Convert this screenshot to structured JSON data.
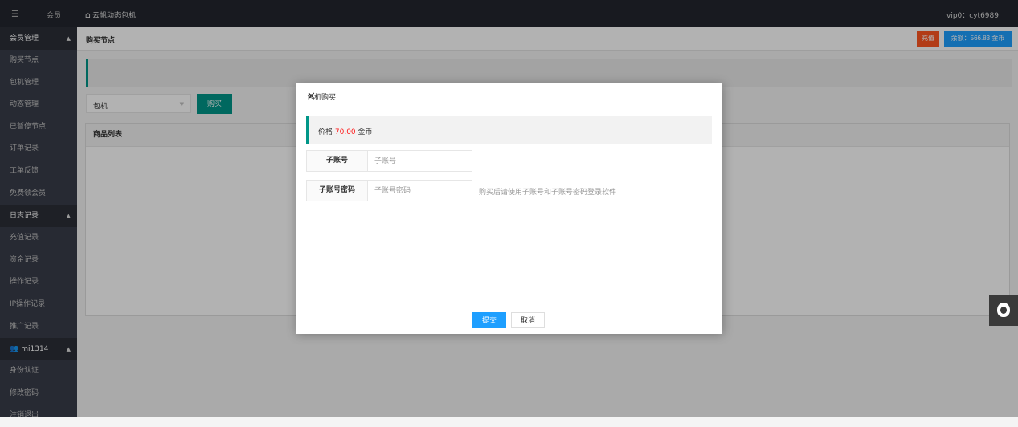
{
  "topbar": {
    "menu_icon": "list-toggle-icon",
    "member_label": "会员",
    "home_icon": "home-icon",
    "breadcrumb": "云帆动态包机",
    "user": "vip0：cyt6989"
  },
  "sidebar": {
    "groups": [
      {
        "label": "会员管理",
        "items": [
          "购买节点",
          "包机管理",
          "动态管理",
          "已暂停节点",
          "订单记录",
          "工单反馈",
          "免费领会员"
        ]
      },
      {
        "label": "日志记录",
        "items": [
          "充值记录",
          "资金记录",
          "操作记录",
          "IP操作记录",
          "推广记录"
        ]
      },
      {
        "label": "mi1314",
        "icon": "users-icon",
        "items": [
          "身份认证",
          "修改密码",
          "注销退出"
        ]
      }
    ]
  },
  "main": {
    "title": "购买节点",
    "recharge_label": "充值",
    "balance_label": "余额：566.83 金币",
    "select_value": "包机",
    "buy_label": "购买",
    "panel_title": "商品列表"
  },
  "dialog": {
    "title": "包机购买",
    "close_icon": "close-icon",
    "price_prefix": "价格",
    "price_value": "70.00",
    "price_unit": "金币",
    "fields": [
      {
        "label": "子账号",
        "placeholder": "子账号"
      },
      {
        "label": "子账号密码",
        "placeholder": "子账号密码"
      }
    ],
    "hint": "购买后请使用子账号和子账号密码登录软件",
    "submit_label": "提交",
    "cancel_label": "取消"
  },
  "floating": {
    "qq_icon": "qq-icon"
  },
  "colors": {
    "topbar": "#23262e",
    "sidebar": "#393d49",
    "accent_green": "#009688",
    "recharge": "#ff5722",
    "primary_blue": "#1e9fff",
    "price_red": "#ff1a1a"
  }
}
